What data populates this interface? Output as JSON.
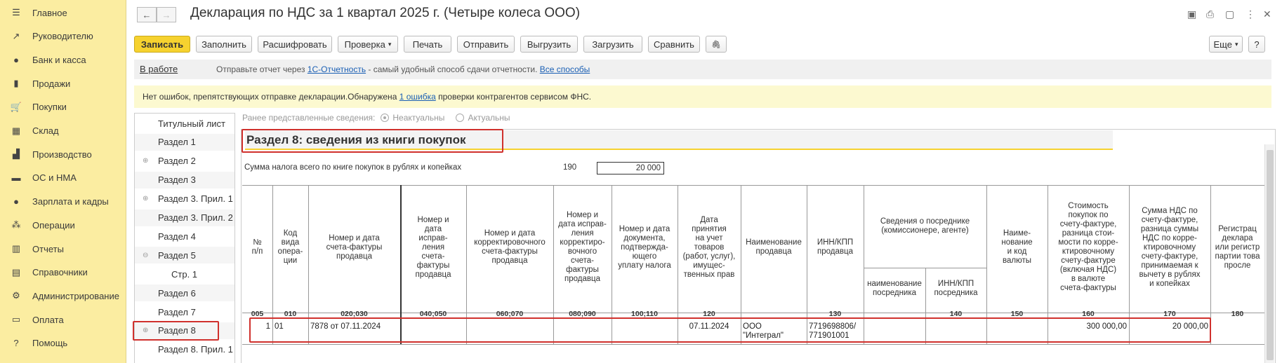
{
  "sidebar": {
    "items": [
      {
        "icon": "menu-icon",
        "glyph": "☰",
        "label": "Главное"
      },
      {
        "icon": "trend-icon",
        "glyph": "↗",
        "label": "Руководителю"
      },
      {
        "icon": "bank-icon",
        "glyph": "●",
        "label": "Банк и касса"
      },
      {
        "icon": "bag-icon",
        "glyph": "▮",
        "label": "Продажи"
      },
      {
        "icon": "cart-icon",
        "glyph": "🛒",
        "label": "Покупки"
      },
      {
        "icon": "warehouse-icon",
        "glyph": "▦",
        "label": "Склад"
      },
      {
        "icon": "factory-icon",
        "glyph": "▟",
        "label": "Производство"
      },
      {
        "icon": "truck-icon",
        "glyph": "▬",
        "label": "ОС и НМА"
      },
      {
        "icon": "person-icon",
        "glyph": "●",
        "label": "Зарплата и кадры"
      },
      {
        "icon": "operations-icon",
        "glyph": "⁂",
        "label": "Операции"
      },
      {
        "icon": "reports-icon",
        "glyph": "▥",
        "label": "Отчеты"
      },
      {
        "icon": "book-icon",
        "glyph": "▤",
        "label": "Справочники"
      },
      {
        "icon": "gear-icon",
        "glyph": "⚙",
        "label": "Администрирование"
      },
      {
        "icon": "payment-icon",
        "glyph": "▭",
        "label": "Оплата"
      },
      {
        "icon": "help-icon",
        "glyph": "?",
        "label": "Помощь"
      }
    ]
  },
  "header": {
    "back_glyph": "←",
    "forward_glyph": "→",
    "title": "Декларация по НДС за 1 квартал 2025 г. (Четыре колеса ООО)",
    "icons": {
      "save": "▣",
      "print": "⎙",
      "copy": "▢",
      "more": "⋮",
      "close": "✕"
    }
  },
  "toolbar": {
    "save": "Записать",
    "fill": "Заполнить",
    "decode": "Расшифровать",
    "check": "Проверка",
    "print": "Печать",
    "send": "Отправить",
    "unload": "Выгрузить",
    "load": "Загрузить",
    "compare": "Сравнить",
    "attach_glyph": "🖇",
    "more": "Еще",
    "help": "?",
    "dropdown_glyph": "▾"
  },
  "status": {
    "state_link": "В работе",
    "text_before": "Отправьте отчет через ",
    "link1": "1С-Отчетность",
    "text_middle": " - самый удобный способ сдачи отчетности. ",
    "link2": "Все способы"
  },
  "notice": {
    "text_before": "Нет ошибок, препятствующих отправке декларации.Обнаружена ",
    "link": "1 ошибка",
    "text_after": " проверки контрагентов сервисом ФНС."
  },
  "tree": {
    "items": [
      {
        "label": "Титульный лист",
        "plus": ""
      },
      {
        "label": "Раздел 1",
        "plus": ""
      },
      {
        "label": "Раздел 2",
        "plus": "⊕"
      },
      {
        "label": "Раздел 3",
        "plus": ""
      },
      {
        "label": "Раздел 3. Прил. 1",
        "plus": "⊕"
      },
      {
        "label": "Раздел 3. Прил. 2",
        "plus": ""
      },
      {
        "label": "Раздел 4",
        "plus": ""
      },
      {
        "label": "Раздел 5",
        "plus": "⊖"
      },
      {
        "label": "Стр. 1",
        "plus": ""
      },
      {
        "label": "Раздел 6",
        "plus": ""
      },
      {
        "label": "Раздел 7",
        "plus": ""
      },
      {
        "label": "Раздел 8",
        "plus": "⊕"
      },
      {
        "label": "Раздел 8. Прил. 1",
        "plus": ""
      }
    ]
  },
  "prev_info": {
    "label": "Ранее представленные сведения:",
    "opt1": "Неактуальны",
    "opt2": "Актуальны"
  },
  "section": {
    "title": "Раздел 8: сведения из книги покупок",
    "sum_label": "Сумма налога всего по книге покупок в рублях и копейках",
    "sum_code": "190",
    "sum_value": "20 000"
  },
  "table": {
    "headers": {
      "num": "№\nп/п",
      "code": "Код\nвида\nопера-\nции",
      "invoice": "Номер и дата\nсчета-фактуры\nпродавца",
      "corr": "Номер и\nдата\nиспрaв-\nления\nсчета-\nфактуры\nпродавца",
      "adj": "Номер и дата\nкорректировочного\nсчета-фактуры\nпродавца",
      "adjcorr": "Номер и\nдата исправ-\nления\nкорректиро-\nвочного\nсчета-\nфактуры\nпродавца",
      "paydoc": "Номер и дата\nдокумента,\nподтвержда-\nющего\nуплату налога",
      "accept": "Дата\nпринятия\nна учет\nтоваров\n(работ, услуг),\nимущес-\nтвенных прав",
      "seller": "Наименование\nпродавца",
      "inn": "ИНН/КПП\nпродавца",
      "agent": "Сведения о посреднике\n(комиссионере, агенте)",
      "agent_name": "наименование\nпосредника",
      "agent_inn": "ИНН/КПП\nпосредника",
      "currency": "Наиме-\nнование\nи код\nвалюты",
      "cost": "Стоимость\nпокупок по\nсчету-фактуре,\nразница стои-\nмости по корре-\nктировочному\nсчету-фактуре\n(включая НДС)\nв валюте\nсчета-фактуры",
      "vat": "Сумма НДС по\nсчету-фактуре,\nразница суммы\nНДС по корре-\nктировочному\nсчету-фактуре,\nпринимаемая к\nвычету в рублях\nи копейках",
      "reg": "Регистрац\nдеклара\nили регистр\nпартии това\nпросле"
    },
    "codes": [
      "005",
      "010",
      "020;030",
      "040;050",
      "060;070",
      "080;090",
      "100;110",
      "120",
      "",
      "130",
      "",
      "140",
      "150",
      "160",
      "170",
      "180",
      ""
    ],
    "row": {
      "num": "1",
      "code": "01",
      "invoice": "7878 от 07.11.2024",
      "accept": "07.11.2024",
      "seller": "ООО \"Интеграл\"",
      "inn": "7719698806/\n771901001",
      "cost": "300 000,00",
      "vat": "20 000,00"
    }
  }
}
